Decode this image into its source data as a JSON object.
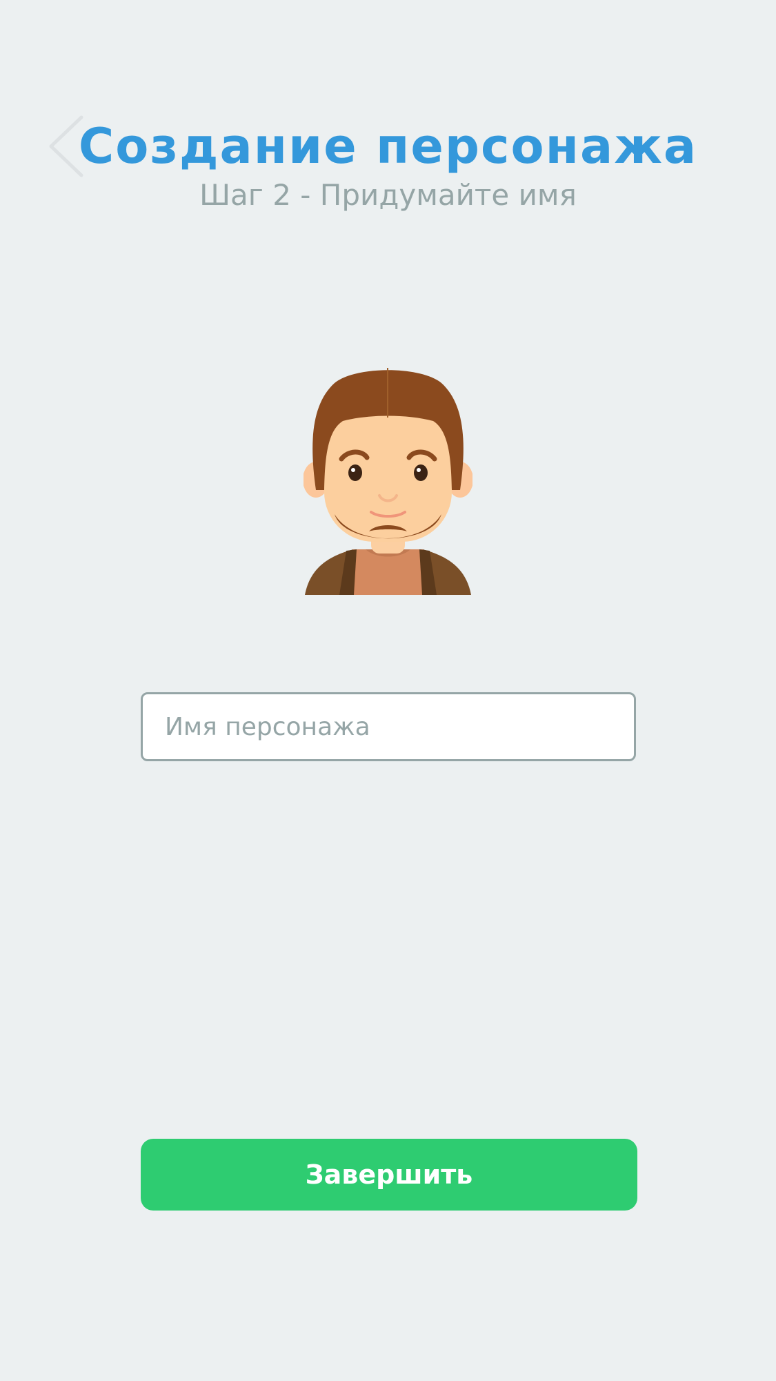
{
  "header": {
    "title": "Создание персонажа",
    "subtitle": "Шаг 2 - Придумайте имя",
    "back_icon": "chevron-left-icon"
  },
  "avatar": {
    "icon": "bearded-man-avatar"
  },
  "name_input": {
    "placeholder": "Имя персонажа",
    "value": ""
  },
  "actions": {
    "finish_label": "Завершить"
  },
  "colors": {
    "background": "#ecf0f1",
    "title": "#3498db",
    "subtitle": "#95a5a6",
    "button": "#2ecc71",
    "input_border": "#95a5a6"
  }
}
